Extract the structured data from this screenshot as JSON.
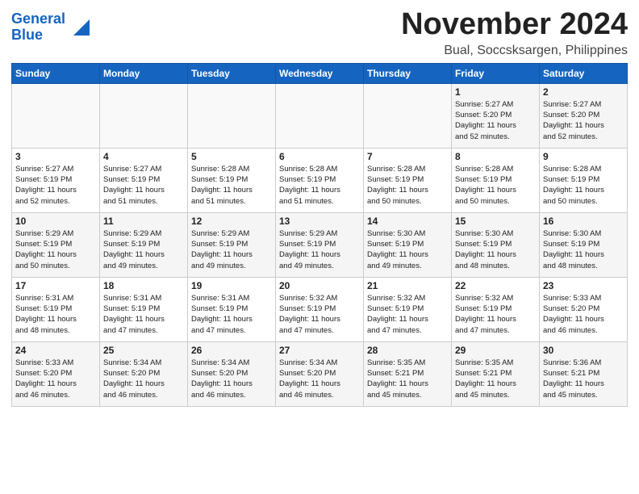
{
  "header": {
    "logo_line1": "General",
    "logo_line2": "Blue",
    "month_title": "November 2024",
    "location": "Bual, Soccsksargen, Philippines"
  },
  "weekdays": [
    "Sunday",
    "Monday",
    "Tuesday",
    "Wednesday",
    "Thursday",
    "Friday",
    "Saturday"
  ],
  "weeks": [
    [
      {
        "day": "",
        "info": ""
      },
      {
        "day": "",
        "info": ""
      },
      {
        "day": "",
        "info": ""
      },
      {
        "day": "",
        "info": ""
      },
      {
        "day": "",
        "info": ""
      },
      {
        "day": "1",
        "info": "Sunrise: 5:27 AM\nSunset: 5:20 PM\nDaylight: 11 hours\nand 52 minutes."
      },
      {
        "day": "2",
        "info": "Sunrise: 5:27 AM\nSunset: 5:20 PM\nDaylight: 11 hours\nand 52 minutes."
      }
    ],
    [
      {
        "day": "3",
        "info": "Sunrise: 5:27 AM\nSunset: 5:19 PM\nDaylight: 11 hours\nand 52 minutes."
      },
      {
        "day": "4",
        "info": "Sunrise: 5:27 AM\nSunset: 5:19 PM\nDaylight: 11 hours\nand 51 minutes."
      },
      {
        "day": "5",
        "info": "Sunrise: 5:28 AM\nSunset: 5:19 PM\nDaylight: 11 hours\nand 51 minutes."
      },
      {
        "day": "6",
        "info": "Sunrise: 5:28 AM\nSunset: 5:19 PM\nDaylight: 11 hours\nand 51 minutes."
      },
      {
        "day": "7",
        "info": "Sunrise: 5:28 AM\nSunset: 5:19 PM\nDaylight: 11 hours\nand 50 minutes."
      },
      {
        "day": "8",
        "info": "Sunrise: 5:28 AM\nSunset: 5:19 PM\nDaylight: 11 hours\nand 50 minutes."
      },
      {
        "day": "9",
        "info": "Sunrise: 5:28 AM\nSunset: 5:19 PM\nDaylight: 11 hours\nand 50 minutes."
      }
    ],
    [
      {
        "day": "10",
        "info": "Sunrise: 5:29 AM\nSunset: 5:19 PM\nDaylight: 11 hours\nand 50 minutes."
      },
      {
        "day": "11",
        "info": "Sunrise: 5:29 AM\nSunset: 5:19 PM\nDaylight: 11 hours\nand 49 minutes."
      },
      {
        "day": "12",
        "info": "Sunrise: 5:29 AM\nSunset: 5:19 PM\nDaylight: 11 hours\nand 49 minutes."
      },
      {
        "day": "13",
        "info": "Sunrise: 5:29 AM\nSunset: 5:19 PM\nDaylight: 11 hours\nand 49 minutes."
      },
      {
        "day": "14",
        "info": "Sunrise: 5:30 AM\nSunset: 5:19 PM\nDaylight: 11 hours\nand 49 minutes."
      },
      {
        "day": "15",
        "info": "Sunrise: 5:30 AM\nSunset: 5:19 PM\nDaylight: 11 hours\nand 48 minutes."
      },
      {
        "day": "16",
        "info": "Sunrise: 5:30 AM\nSunset: 5:19 PM\nDaylight: 11 hours\nand 48 minutes."
      }
    ],
    [
      {
        "day": "17",
        "info": "Sunrise: 5:31 AM\nSunset: 5:19 PM\nDaylight: 11 hours\nand 48 minutes."
      },
      {
        "day": "18",
        "info": "Sunrise: 5:31 AM\nSunset: 5:19 PM\nDaylight: 11 hours\nand 47 minutes."
      },
      {
        "day": "19",
        "info": "Sunrise: 5:31 AM\nSunset: 5:19 PM\nDaylight: 11 hours\nand 47 minutes."
      },
      {
        "day": "20",
        "info": "Sunrise: 5:32 AM\nSunset: 5:19 PM\nDaylight: 11 hours\nand 47 minutes."
      },
      {
        "day": "21",
        "info": "Sunrise: 5:32 AM\nSunset: 5:19 PM\nDaylight: 11 hours\nand 47 minutes."
      },
      {
        "day": "22",
        "info": "Sunrise: 5:32 AM\nSunset: 5:19 PM\nDaylight: 11 hours\nand 47 minutes."
      },
      {
        "day": "23",
        "info": "Sunrise: 5:33 AM\nSunset: 5:20 PM\nDaylight: 11 hours\nand 46 minutes."
      }
    ],
    [
      {
        "day": "24",
        "info": "Sunrise: 5:33 AM\nSunset: 5:20 PM\nDaylight: 11 hours\nand 46 minutes."
      },
      {
        "day": "25",
        "info": "Sunrise: 5:34 AM\nSunset: 5:20 PM\nDaylight: 11 hours\nand 46 minutes."
      },
      {
        "day": "26",
        "info": "Sunrise: 5:34 AM\nSunset: 5:20 PM\nDaylight: 11 hours\nand 46 minutes."
      },
      {
        "day": "27",
        "info": "Sunrise: 5:34 AM\nSunset: 5:20 PM\nDaylight: 11 hours\nand 46 minutes."
      },
      {
        "day": "28",
        "info": "Sunrise: 5:35 AM\nSunset: 5:21 PM\nDaylight: 11 hours\nand 45 minutes."
      },
      {
        "day": "29",
        "info": "Sunrise: 5:35 AM\nSunset: 5:21 PM\nDaylight: 11 hours\nand 45 minutes."
      },
      {
        "day": "30",
        "info": "Sunrise: 5:36 AM\nSunset: 5:21 PM\nDaylight: 11 hours\nand 45 minutes."
      }
    ]
  ]
}
